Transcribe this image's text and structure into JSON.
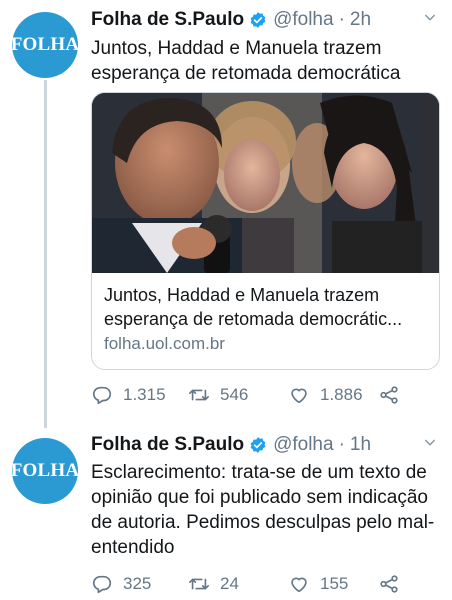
{
  "colors": {
    "brand": "#2b9ad3",
    "verified": "#1da1f2",
    "secondary_text": "#657786",
    "thread_line": "#ccd6dd"
  },
  "tweets": [
    {
      "avatar_logo": "FOLHA",
      "name": "Folha de S.Paulo",
      "handle": "@folha",
      "separator": "·",
      "time": "2h",
      "text": "Juntos, Haddad e Manuela trazem esperança de retomada democrática",
      "card": {
        "title": "Juntos, Haddad e Manuela trazem esperança de retomada democrátic...",
        "domain": "folha.uol.com.br"
      },
      "actions": {
        "replies": "1.315",
        "retweets": "546",
        "likes": "1.886"
      }
    },
    {
      "avatar_logo": "FOLHA",
      "name": "Folha de S.Paulo",
      "handle": "@folha",
      "separator": "·",
      "time": "1h",
      "text": "Esclarecimento: trata-se de um texto de opinião que foi publicado sem indicação de autoria. Pedimos desculpas pelo mal-entendido",
      "actions": {
        "replies": "325",
        "retweets": "24",
        "likes": "155"
      }
    }
  ]
}
